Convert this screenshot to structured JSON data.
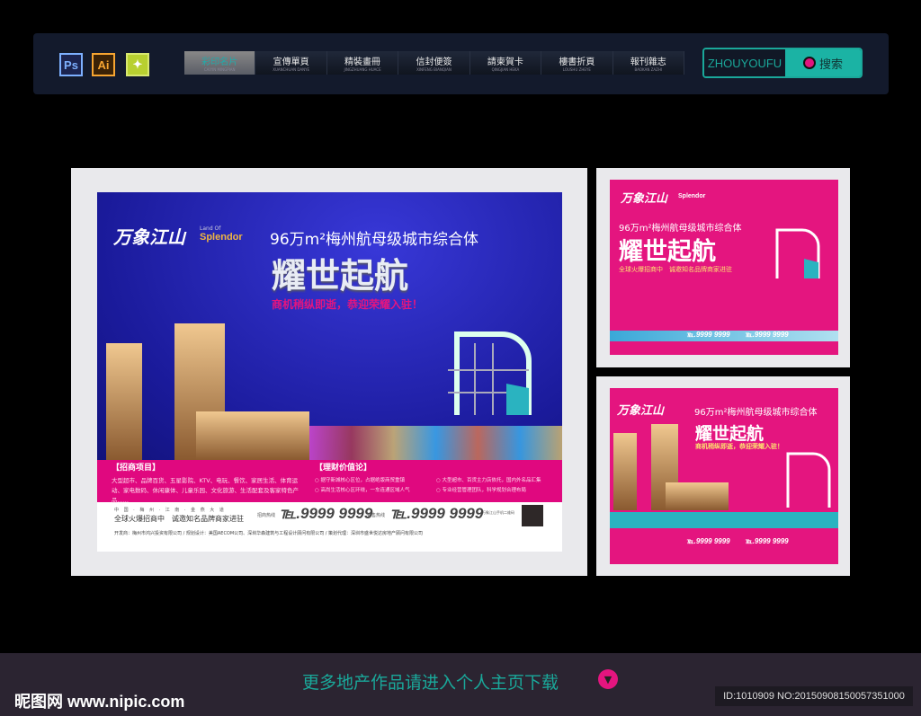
{
  "toolbar": {
    "apps": [
      "Ps",
      "Ai",
      "✦"
    ],
    "nav": [
      {
        "label": "彩印名片",
        "sub": "CAIYIN MINGPIAN"
      },
      {
        "label": "宣傳單頁",
        "sub": "XUANCHUAN DANYE"
      },
      {
        "label": "精裝畫冊",
        "sub": "JINGZHUANG HUACE"
      },
      {
        "label": "信封便簽",
        "sub": "XINFENG BIANQIAN"
      },
      {
        "label": "請柬賀卡",
        "sub": "QINGJIAN HEKA"
      },
      {
        "label": "樓書折頁",
        "sub": "LOUSHU ZHEYE"
      },
      {
        "label": "報刊雜志",
        "sub": "BAOKAN ZAZHI"
      }
    ],
    "search_value": "ZHOUYOUFU",
    "search_label": "搜索"
  },
  "poster": {
    "logo": "万象江山",
    "logo_en_small": "Land Of",
    "logo_en": "Splendor",
    "headline": "96万m²梅州航母级城市综合体",
    "big": "耀世起航",
    "slogan": "商机稍纵即逝，恭迎荣耀入驻！",
    "slogan2": "全球火爆招商中　诚邀知名品牌商家进驻",
    "sec1_title": "【招商项目】",
    "sec1_text": "大型超市、品牌百货、五星影院、KTV、电玩、餐饮、家居生活、体育运动、家电数码、休闲康体、儿童乐园、文化旅游、生活配套及客家特色产品......",
    "sec2_title": "【理财价值论】",
    "sec2_items": [
      "○ 据守新城核心区位，占据绝版商贸重镇",
      "○ 大型超市、百货主力店依托，国内外名品汇集",
      "○ 高尚生活核心区环绕，一车连通区域人气",
      "○ 专业经营管理团队，科学规划合理布局"
    ],
    "address": "中 国 · 梅 州 · 江 南 · 金 燕 大 道",
    "hotline1_label": "招商热线",
    "hotline1": "℡.9999 9999",
    "hotline2_label": "销售热线",
    "hotline2": "℡.9999 9999",
    "qr_label": "万象江山手机二维码",
    "credits": "开发商：梅州市鸿兴投资有限公司 / 规划设计：美国AECOM公司、深圳华森建筑与工程设计顾问有限公司 / 策划代理：深圳市盛世悦达房地产顾问有限公司"
  },
  "footer": {
    "cta": "更多地产作品请进入个人主页下载",
    "watermark": "昵图网 www.nipic.com",
    "id": "ID:1010909 NO:20150908150057351000"
  },
  "colors": {
    "accent": "#1bb3a4",
    "pink": "#e4157f",
    "blue": "#1a1a9a"
  }
}
